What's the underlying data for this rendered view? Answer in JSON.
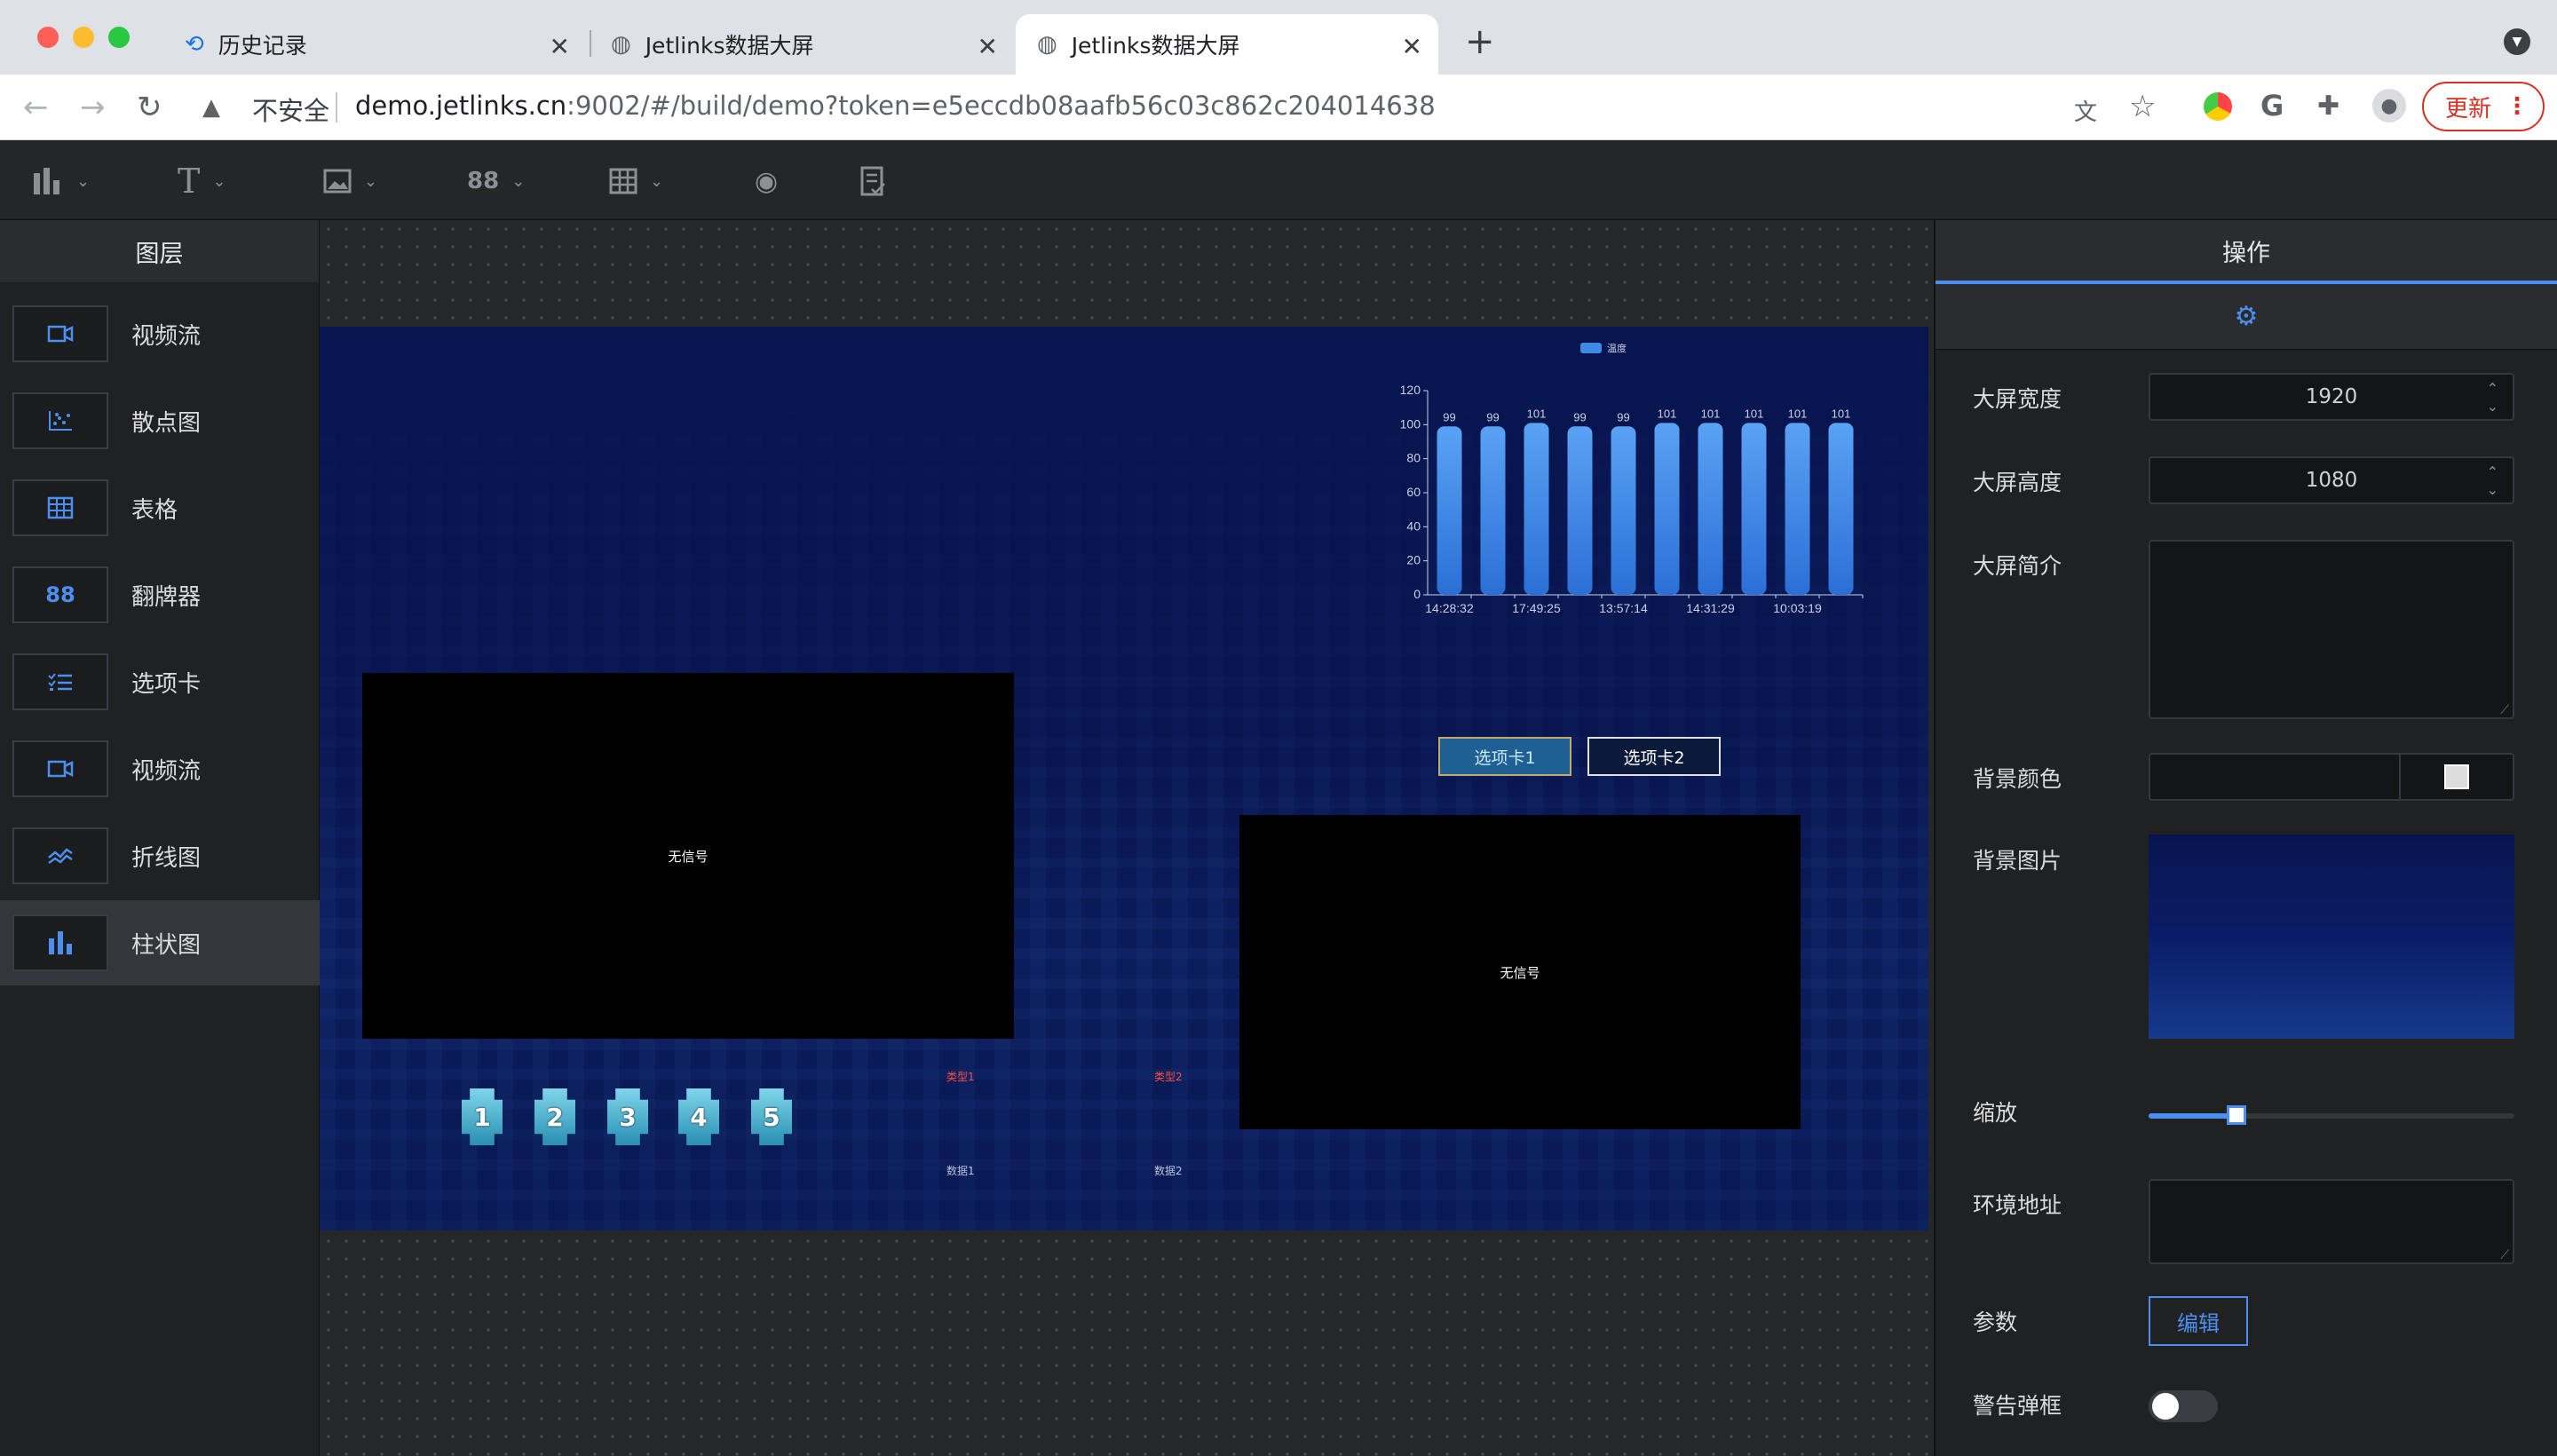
{
  "browser": {
    "tabs": [
      {
        "title": "历史记录",
        "icon": "history-icon"
      },
      {
        "title": "Jetlinks数据大屏",
        "icon": "globe-icon"
      },
      {
        "title": "Jetlinks数据大屏",
        "icon": "globe-icon",
        "active": true
      }
    ],
    "new_tab": "+",
    "security_label": "不安全",
    "url_host": "demo.jetlinks.cn",
    "url_path": ":9002/#/build/demo?token=e5eccdb08aafb56c03c862c204014638",
    "update_label": "更新"
  },
  "toolbar": {
    "tools": [
      "chart-tool-icon",
      "text-tool-icon",
      "image-tool-icon",
      "widget-tool-icon",
      "table-tool-icon",
      "preview-eye-icon",
      "save-doc-icon"
    ]
  },
  "left_panel": {
    "title": "图层",
    "layers": [
      {
        "label": "视频流",
        "icon": "video-icon"
      },
      {
        "label": "散点图",
        "icon": "scatter-icon"
      },
      {
        "label": "表格",
        "icon": "table-icon"
      },
      {
        "label": "翻牌器",
        "icon": "flipper-icon"
      },
      {
        "label": "选项卡",
        "icon": "tabs-icon"
      },
      {
        "label": "视频流",
        "icon": "video-icon"
      },
      {
        "label": "折线图",
        "icon": "line-chart-icon"
      },
      {
        "label": "柱状图",
        "icon": "bar-chart-icon",
        "selected": true
      }
    ]
  },
  "canvas": {
    "background_color": "#08154f",
    "video1_text": "无信号",
    "video2_text": "无信号",
    "tab1": "选项卡1",
    "tab2": "选项卡2",
    "flippers": [
      "1",
      "2",
      "3",
      "4",
      "5"
    ],
    "type1": "类型1",
    "type2": "类型2",
    "data1": "数据1",
    "data2": "数据2"
  },
  "chart_data": {
    "type": "bar",
    "legend": [
      "温度"
    ],
    "categories": [
      "14:28:32",
      "",
      "17:49:25",
      "",
      "13:57:14",
      "",
      "14:31:29",
      "",
      "10:03:19",
      ""
    ],
    "series": [
      {
        "name": "温度",
        "values": [
          99,
          99,
          101,
          99,
          99,
          101,
          101,
          101,
          101,
          101
        ]
      }
    ],
    "yticks": [
      "0",
      "20",
      "40",
      "60",
      "80",
      "100",
      "120"
    ],
    "ylim": [
      0,
      120
    ],
    "bar_color": "#3f8ae6"
  },
  "right_panel": {
    "title": "操作",
    "settings_icon": "gear-icon",
    "width_label": "大屏宽度",
    "width_value": "1920",
    "height_label": "大屏高度",
    "height_value": "1080",
    "intro_label": "大屏简介",
    "bg_color_label": "背景颜色",
    "bg_image_label": "背景图片",
    "scale_label": "缩放",
    "scale_value": 0.24,
    "env_label": "环境地址",
    "params_label": "参数",
    "edit_label": "编辑",
    "alert_label": "警告弹框",
    "alert_on": false
  }
}
